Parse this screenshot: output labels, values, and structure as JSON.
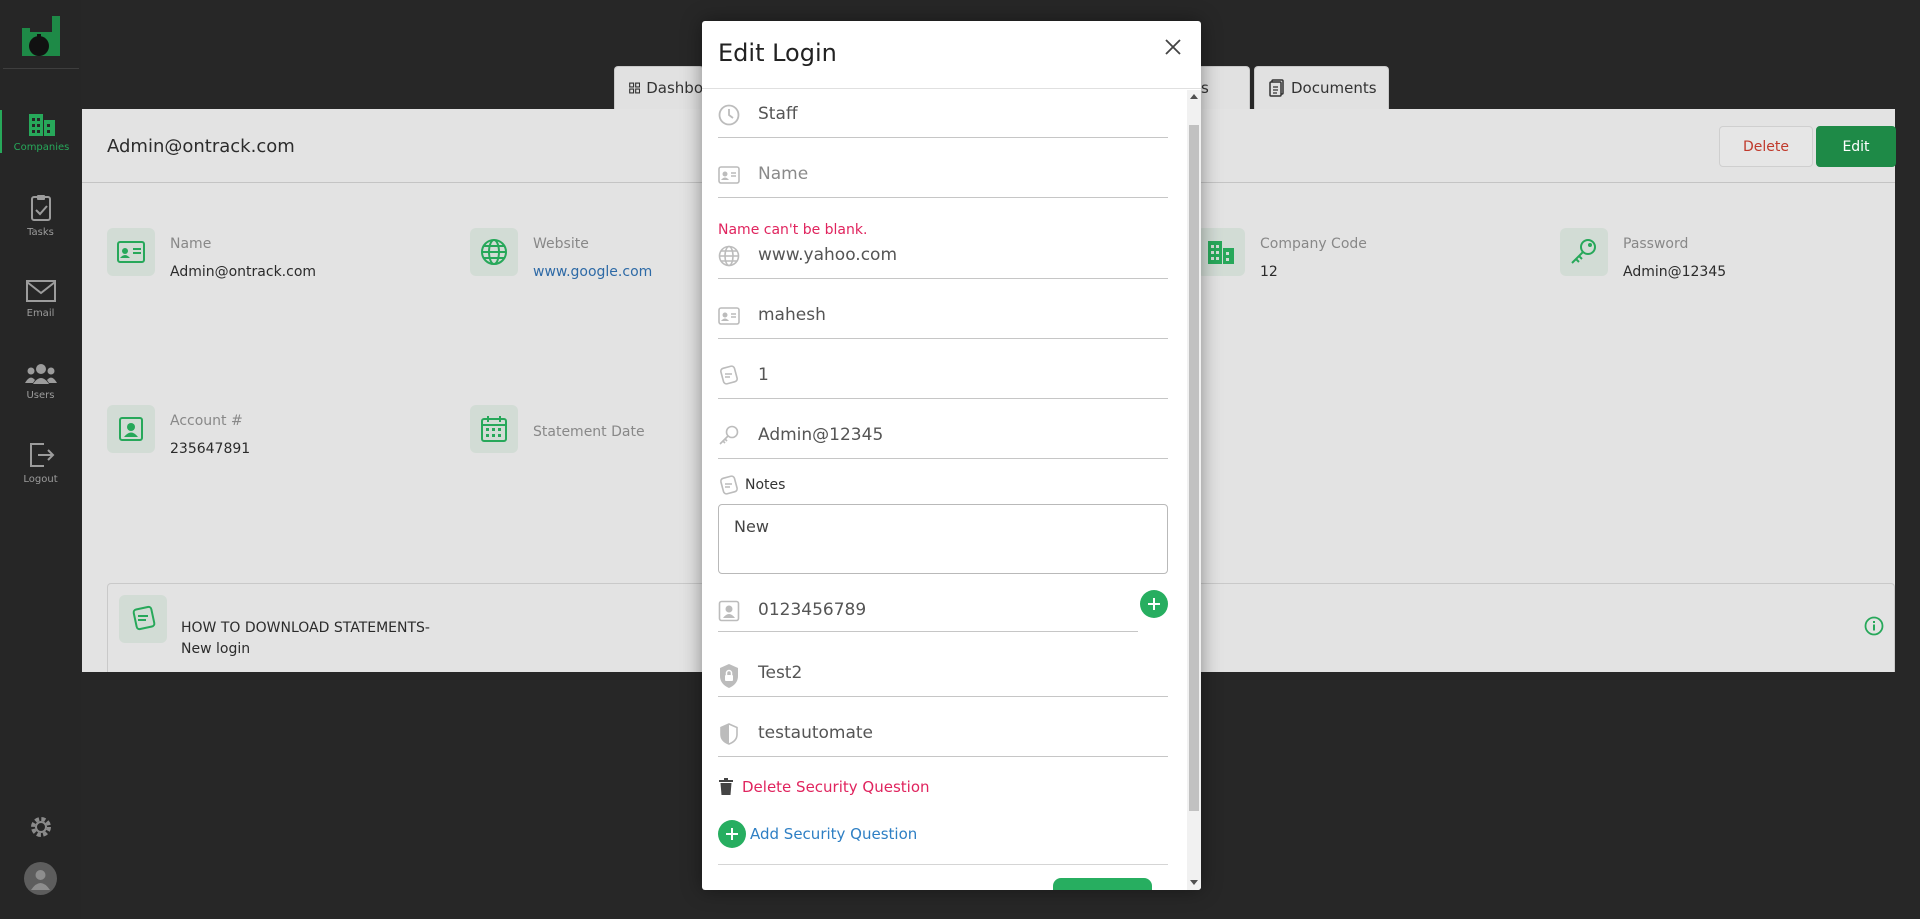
{
  "sidebar": {
    "items": [
      {
        "label": "Companies",
        "icon": "building-icon",
        "active": true
      },
      {
        "label": "Tasks",
        "icon": "clipboard-check-icon"
      },
      {
        "label": "Email",
        "icon": "envelope-icon"
      },
      {
        "label": "Users",
        "icon": "users-icon"
      },
      {
        "label": "Logout",
        "icon": "logout-icon"
      }
    ]
  },
  "tabs": [
    {
      "label": "Dashbo",
      "icon": "grid-icon"
    },
    {
      "label": "s"
    },
    {
      "label": "Documents",
      "icon": "documents-icon"
    }
  ],
  "page": {
    "title": "Admin@ontrack.com",
    "delete_label": "Delete",
    "edit_label": "Edit",
    "fields": {
      "name": {
        "label": "Name",
        "value": "Admin@ontrack.com"
      },
      "website": {
        "label": "Website",
        "value": "www.google.com"
      },
      "company_code": {
        "label": "Company Code",
        "value": "12"
      },
      "password": {
        "label": "Password",
        "value": "Admin@12345"
      },
      "account": {
        "label": "Account #",
        "value": "235647891"
      },
      "statement": {
        "label": "Statement Date"
      }
    },
    "note": {
      "title": "HOW TO DOWNLOAD STATEMENTS-",
      "subtitle": "New login"
    }
  },
  "modal": {
    "title": "Edit Login",
    "staff": "Staff",
    "name_placeholder": "Name",
    "name_error": "Name can't be blank.",
    "website": "www.yahoo.com",
    "username": "mahesh",
    "company_code": "1",
    "password": "Admin@12345",
    "notes_label": "Notes",
    "notes_value": "New",
    "account_number": "0123456789",
    "security_question": "Test2",
    "security_answer": "testautomate",
    "delete_question_label": "Delete Security Question",
    "add_question_label": "Add Security Question"
  },
  "colors": {
    "accent": "#27ae60",
    "error": "#e0245e",
    "link": "#2e7fc4",
    "sidebar_bg": "#262626"
  }
}
